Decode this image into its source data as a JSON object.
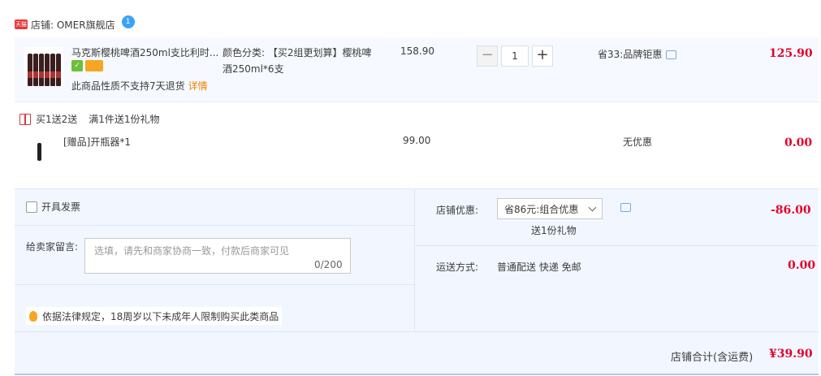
{
  "store": {
    "badge": "天猫",
    "label": "店铺: OMER旗舰店",
    "ww": "1"
  },
  "item": {
    "title": "马克斯樱桃啤酒250ml支比利时...",
    "spec_label": "颜色分类: 【买2组更划算】樱桃啤酒250ml*6支",
    "no_return": "此商品性质不支持7天退货",
    "detail_link": "详情",
    "price": "158.90",
    "qty_minus": "−",
    "qty_value": "1",
    "qty_plus": "+",
    "save": "省33:品牌钜惠",
    "total": "125.90"
  },
  "gift": {
    "heading": "买1送2送",
    "rule": "满1件送1份礼物",
    "name": "[赠品]开瓶器*1",
    "price": "99.00",
    "discount": "无优惠",
    "total": "0.00"
  },
  "order": {
    "invoice_label": "开具发票",
    "message_label": "给卖家留言:",
    "message_placeholder": "选填，请先和商家协商一致，付款后商家可见",
    "message_counter": "0/200",
    "legal_notice": "依据法律规定，18周岁以下未成年人限制购买此类商品",
    "store_discount_label": "店铺优惠:",
    "store_discount_value": "省86元:组合优惠",
    "store_discount_gift": "送1份礼物",
    "store_discount_amount": "-86.00",
    "shipping_label": "运送方式:",
    "shipping_value": "普通配送 快递 免邮",
    "shipping_amount": "0.00",
    "store_total_label": "店铺合计(含运费)",
    "store_total_value": "¥39.90"
  }
}
